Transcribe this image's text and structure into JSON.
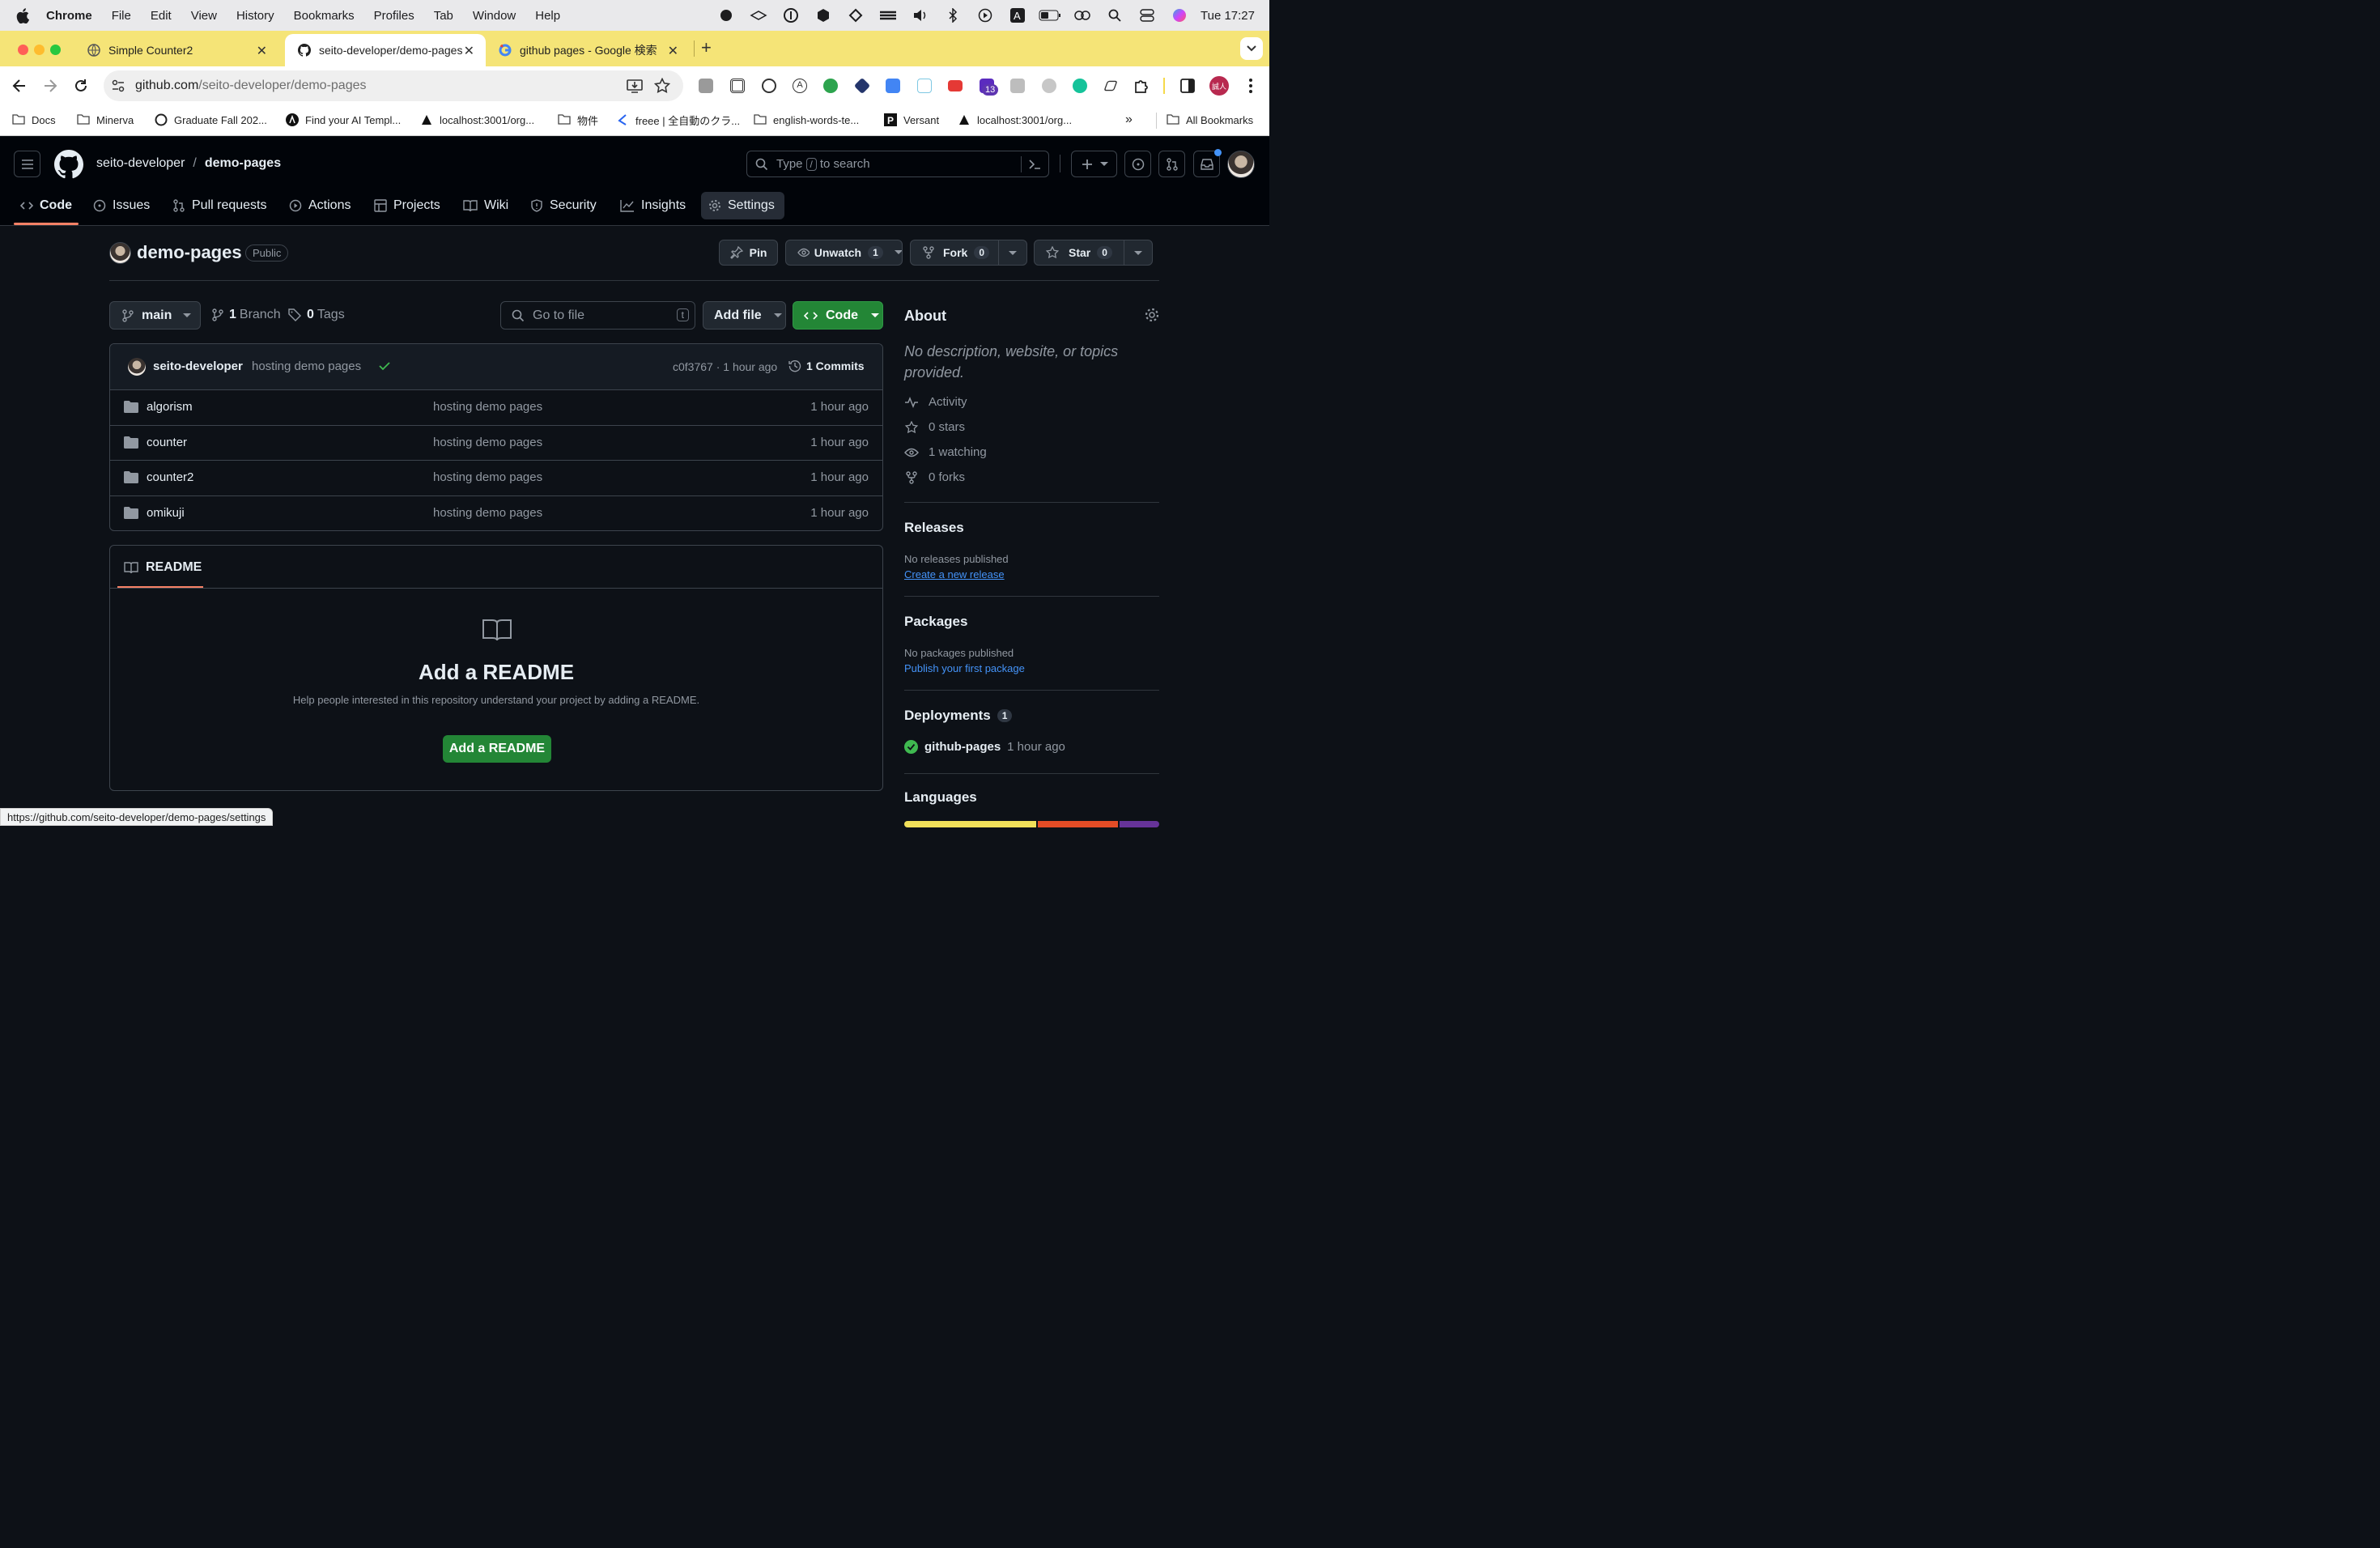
{
  "menubar": {
    "app": "Chrome",
    "items": [
      "File",
      "Edit",
      "View",
      "History",
      "Bookmarks",
      "Profiles",
      "Tab",
      "Window",
      "Help"
    ],
    "clock": "Tue  17:27"
  },
  "tabs": [
    {
      "title": "Simple Counter2"
    },
    {
      "title": "seito-developer/demo-pages"
    },
    {
      "title": "github pages - Google 検索"
    }
  ],
  "omnibox": {
    "host": "github.com",
    "path": "/seito-developer/demo-pages"
  },
  "extensions": {
    "badge": "13",
    "avatar_text": "誠人"
  },
  "bookmarks": [
    "Docs",
    "Minerva",
    "Graduate Fall 202...",
    "Find your AI Templ...",
    "localhost:3001/org...",
    "物件",
    "freee | 全自動のクラ...",
    "english-words-te...",
    "Versant",
    "localhost:3001/org..."
  ],
  "bookmarks_all": "All Bookmarks",
  "gh": {
    "owner": "seito-developer",
    "sep": "/",
    "repo": "demo-pages",
    "search_prefix": "Type",
    "search_key": "/",
    "search_suffix": "to search",
    "nav": [
      "Code",
      "Issues",
      "Pull requests",
      "Actions",
      "Projects",
      "Wiki",
      "Security",
      "Insights",
      "Settings"
    ]
  },
  "repo": {
    "name": "demo-pages",
    "visibility": "Public",
    "pin": "Pin",
    "unwatch": "Unwatch",
    "watch_count": "1",
    "fork": "Fork",
    "fork_count": "0",
    "star": "Star",
    "star_count": "0"
  },
  "branchbar": {
    "branch": "main",
    "branches_num": "1",
    "branches_label": "Branch",
    "tags_num": "0",
    "tags_label": "Tags",
    "goto_placeholder": "Go to file",
    "goto_key": "t",
    "add_file": "Add file",
    "code": "Code"
  },
  "commit": {
    "author": "seito-developer",
    "message": "hosting demo pages",
    "meta": "c0f3767 · 1 hour ago",
    "commits": "1 Commits"
  },
  "files": [
    {
      "name": "algorism",
      "message": "hosting demo pages",
      "ago": "1 hour ago"
    },
    {
      "name": "counter",
      "message": "hosting demo pages",
      "ago": "1 hour ago"
    },
    {
      "name": "counter2",
      "message": "hosting demo pages",
      "ago": "1 hour ago"
    },
    {
      "name": "omikuji",
      "message": "hosting demo pages",
      "ago": "1 hour ago"
    }
  ],
  "readme": {
    "tab": "README",
    "title": "Add a README",
    "help": "Help people interested in this repository understand your project by adding a README.",
    "button": "Add a README"
  },
  "about": {
    "title": "About",
    "description": "No description, website, or topics provided.",
    "activity": "Activity",
    "stars": "0 stars",
    "watching": "1 watching",
    "forks": "0 forks"
  },
  "releases": {
    "title": "Releases",
    "none": "No releases published",
    "link": "Create a new release"
  },
  "packages": {
    "title": "Packages",
    "none": "No packages published",
    "link": "Publish your first package"
  },
  "deployments": {
    "title": "Deployments",
    "count": "1",
    "env": "github-pages",
    "ago": "1 hour ago"
  },
  "languages": {
    "title": "Languages"
  },
  "statusbar": "https://github.com/seito-developer/demo-pages/settings",
  "colors": {
    "accent": "#238636",
    "link": "#4493f8",
    "tab_underline": "#f78166",
    "tabbar": "#f5e477"
  }
}
